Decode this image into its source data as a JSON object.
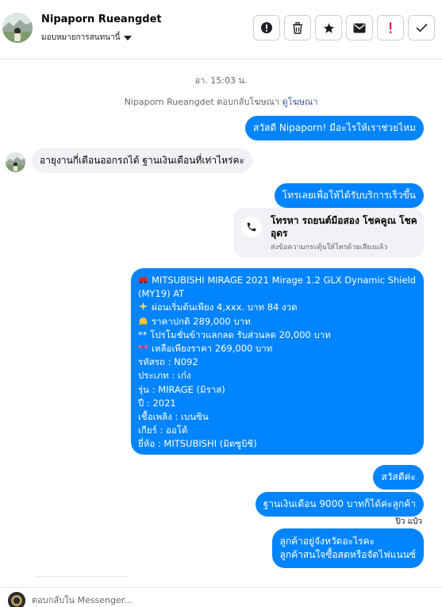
{
  "header": {
    "contact_name": "Nipaporn Rueangdet",
    "assign_label": "มอบหมายการสนทนานี้",
    "actions": [
      {
        "name": "report-spam-button",
        "icon": "exclamation-circle-icon"
      },
      {
        "name": "delete-button",
        "icon": "trash-icon"
      },
      {
        "name": "star-button",
        "icon": "star-icon"
      },
      {
        "name": "mark-unread-button",
        "icon": "envelope-icon"
      },
      {
        "name": "follow-up-button",
        "icon": "exclamation-icon",
        "color": "#e41e3f"
      },
      {
        "name": "done-button",
        "icon": "checkmark-icon"
      }
    ]
  },
  "thread": {
    "timestamp": "อา. 15:03 น.",
    "reply_note": "Nipaporn Rueangdet ตอบกลับโฆษณา",
    "reply_note_link": "ดูโฆษณา",
    "messages": {
      "greeting": "สวัสดี Nipaporn! มีอะไรให้เราช่วยไหม",
      "customer_question": "อายุงานกี่เดือนออกรถได้ ฐานเงินเดือนที่เท่าไหร่คะ",
      "call_prompt": "โทรเลยเพื่อให้ได้รับบริการเร็วขึ้น",
      "call_card_title": "โทรหา รถยนต์มือสอง โชคคูณ โชค อุดร",
      "call_card_subtitle": "ส่งข้อความกระตุ้นให้โทรด้วยเสียงแล้ว",
      "car_details": [
        "MITSUBISHI MIRAGE 2021 Mirage 1.2 GLX Dynamic Shield",
        "(MY19) AT",
        "ผ่อนเริ่มต้นเพียง 4,xxx. บาท 84 งวด",
        "ราคาปกติ 289,000 บาท",
        "** โปรโมชั่นข้าวแลกลด รับส่วนลด 20,000 บาท",
        "เหลือเพียงราคา 269,000 บาท",
        "รหัสรถ : N092",
        "ประเภท : เก๋ง",
        "รุ่น : MIRAGE (มิราส)",
        "ปี : 2021",
        "เชื้อเพลิง : เบนซิน",
        "เกียร์ : ออโต้",
        "ยี่ห้อ : MITSUBISHI (มิตซูบิชิ)"
      ],
      "hello": "สวัสดีค่ะ",
      "salary": "ฐานเงินเดือน 9000 บาทก็ได้ค่ะลูกค้า",
      "seen_by": "ปิว แป๋ว",
      "province_line1": "ลูกค้าอยู่จังหวัดอะไรคะ",
      "province_line2": "ลูกค้าสนใจซื้อสดหรือจัดไฟแนนซ์"
    },
    "bubble_colors": {
      "outgoing": "#0084ff",
      "incoming": "#f0f2f5"
    }
  },
  "composer": {
    "placeholder": "ตอบกลับใน Messenger..."
  }
}
